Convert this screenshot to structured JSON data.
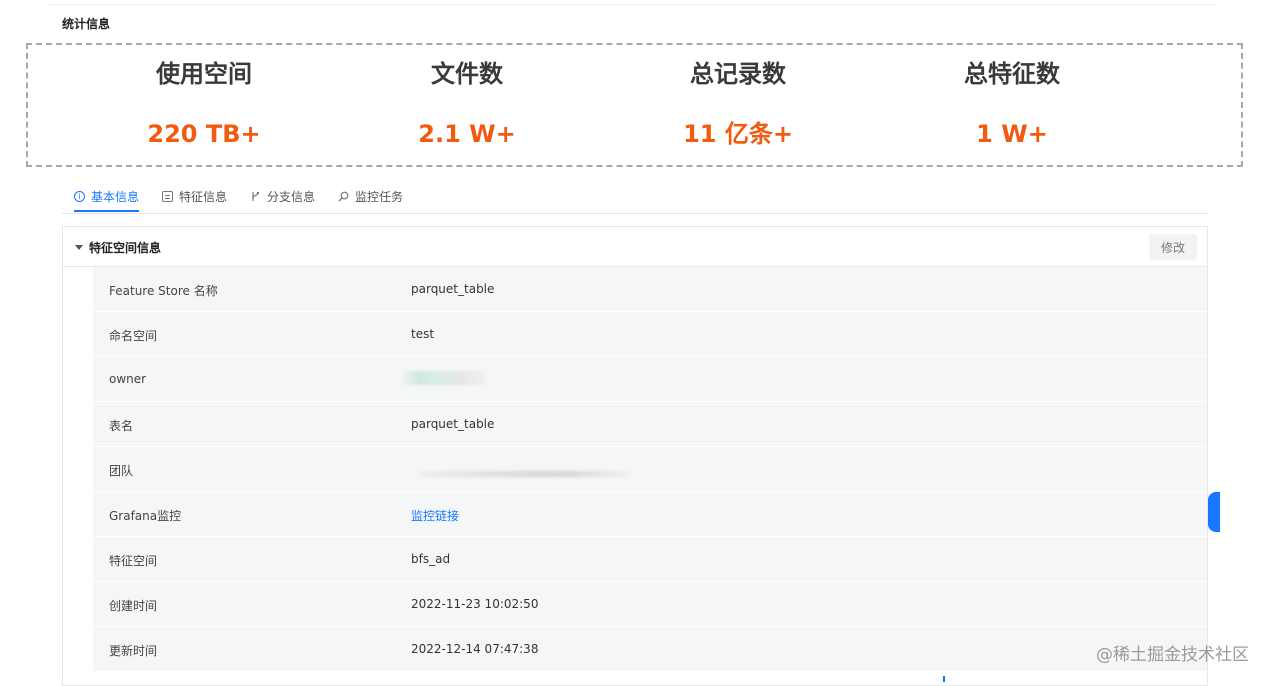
{
  "section_title": "统计信息",
  "stats": [
    {
      "label": "使用空间",
      "value": "220 TB+"
    },
    {
      "label": "文件数",
      "value": "2.1 W+"
    },
    {
      "label": "总记录数",
      "value": "11 亿条+"
    },
    {
      "label": "总特征数",
      "value": "1 W+"
    }
  ],
  "tabs": [
    {
      "label": "基本信息",
      "icon": "info-icon",
      "active": true
    },
    {
      "label": "特征信息",
      "icon": "list-icon"
    },
    {
      "label": "分支信息",
      "icon": "branch-icon"
    },
    {
      "label": "监控任务",
      "icon": "search-icon"
    }
  ],
  "panel": {
    "title": "特征空间信息",
    "edit_label": "修改",
    "rows": [
      {
        "key": "Feature Store 名称",
        "value": "parquet_table"
      },
      {
        "key": "命名空间",
        "value": "test"
      },
      {
        "key": "owner",
        "value": ""
      },
      {
        "key": "表名",
        "value": "parquet_table"
      },
      {
        "key": "团队",
        "value": ""
      },
      {
        "key": "Grafana监控",
        "value": "监控链接"
      },
      {
        "key": "特征空间",
        "value": "bfs_ad"
      },
      {
        "key": "创建时间",
        "value": "2022-11-23 10:02:50"
      },
      {
        "key": "更新时间",
        "value": "2022-12-14 07:47:38"
      }
    ]
  },
  "watermark": "@稀土掘金技术社区",
  "colors": {
    "accent": "#1677ff",
    "stat_value": "#f25a0f"
  }
}
